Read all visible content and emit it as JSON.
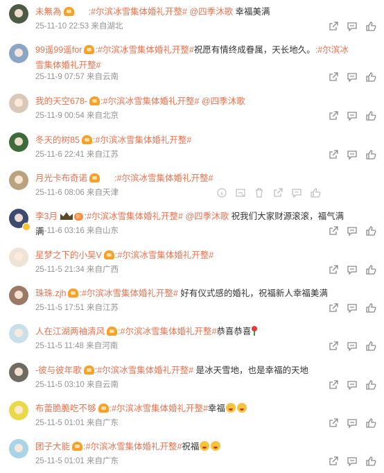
{
  "comments": [
    {
      "name": "未無為",
      "badge": "vip1",
      "level": "",
      "segments": [
        {
          "t": "topic",
          "v": ":#尔滨冰雪集体婚礼开整#"
        },
        {
          "t": "at",
          "v": " @四季沐歌"
        },
        {
          "t": "text",
          "v": " 幸福美满"
        }
      ],
      "time": "25-11-10 22:53",
      "source": "来自湖北",
      "avatar_color": "#4d5b45"
    },
    {
      "name": "99遥99遥for",
      "badge": "crown",
      "level": "",
      "segments": [
        {
          "t": "topic",
          "v": ":#尔滨冰雪集体婚礼开整#"
        },
        {
          "t": "text",
          "v": "祝愿有情终成眷属，天长地久。"
        },
        {
          "t": "topic",
          "v": ":#尔滨冰雪集体婚礼开整#"
        }
      ],
      "time": "25-11-9 07:57",
      "source": "来自云南",
      "avatar_color": "#8aa6c4"
    },
    {
      "name": "我的天空678-",
      "badge": "crown",
      "level": "",
      "segments": [
        {
          "t": "topic",
          "v": ":#尔滨冰雪集体婚礼开整#"
        },
        {
          "t": "at",
          "v": " @四季沐歌"
        }
      ],
      "time": "25-11-9 00:54",
      "source": "来自北京",
      "avatar_color": "#d9c8b8"
    },
    {
      "name": "冬天的树85",
      "badge": "crown",
      "level": "",
      "segments": [
        {
          "t": "topic",
          "v": ":#尔滨冰雪集体婚礼开整#"
        }
      ],
      "time": "25-11-6 22:41",
      "source": "来自江苏",
      "avatar_color": "#3f6b3a"
    },
    {
      "name": "月光卡布奇诺",
      "badge": "vip1",
      "level": "",
      "segments": [
        {
          "t": "topic",
          "v": ":#尔滨冰雪集体婚礼开整#"
        }
      ],
      "time": "25-11-6 08:06",
      "source": "来自天津",
      "avatar_color": "#b9a27d",
      "pale": true
    },
    {
      "name": "李3月",
      "badge": "crown-big",
      "level": "III",
      "segments": [
        {
          "t": "topic",
          "v": ":#尔滨冰雪集体婚礼开整#"
        },
        {
          "t": "at",
          "v": " @四季沐歌"
        },
        {
          "t": "text",
          "v": " 祝我们大家财源滚滚，福气满满"
        }
      ],
      "time": "25-11-6 03:16",
      "source": "来自山东",
      "avatar_color": "#3b4a6e",
      "vip_dot": true
    },
    {
      "name": "星梦之下的小吴V",
      "badge": "crown",
      "level": "",
      "segments": [
        {
          "t": "topic",
          "v": ":#尔滨冰雪集体婚礼开整#"
        }
      ],
      "time": "25-11-5 21:34",
      "source": "来自广西",
      "avatar_color": "#efe2d6"
    },
    {
      "name": "珠珠.zjh",
      "badge": "crown",
      "level": "",
      "segments": [
        {
          "t": "topic",
          "v": ":#尔滨冰雪集体婚礼开整#"
        },
        {
          "t": "text",
          "v": " 好有仪式感的婚礼，祝福新人幸福美满"
        }
      ],
      "time": "25-11-5 17:51",
      "source": "来自江苏",
      "avatar_color": "#9a7a66"
    },
    {
      "name": "人在江湖两袖清风",
      "badge": "crown",
      "level": "",
      "segments": [
        {
          "t": "topic",
          "v": ":#尔滨冰雪集体婚礼开整#"
        },
        {
          "t": "text",
          "v": "恭喜恭喜"
        },
        {
          "t": "rose",
          "v": "rose"
        }
      ],
      "time": "25-11-5 11:48",
      "source": "来自河南",
      "avatar_color": "#c9dfe9"
    },
    {
      "name": "-彼与彼年歌",
      "badge": "crown",
      "level": "",
      "segments": [
        {
          "t": "topic",
          "v": ":#尔滨冰雪集体婚礼开整#"
        },
        {
          "t": "text",
          "v": " 是冰天雪地，也是幸福的天地"
        }
      ],
      "time": "25-11-5 03:10",
      "source": "来自云南",
      "avatar_color": "#6f6a62"
    },
    {
      "name": "布蕾脆脆吃不够",
      "badge": "crown",
      "level": "",
      "segments": [
        {
          "t": "topic",
          "v": ":#尔滨冰雪集体婚礼开整#"
        },
        {
          "t": "text",
          "v": "幸福"
        },
        {
          "t": "emoji",
          "v": "emoji"
        },
        {
          "t": "emoji",
          "v": "emoji"
        }
      ],
      "time": "25-11-5 01:01",
      "source": "来自广东",
      "avatar_color": "#e9d94a"
    },
    {
      "name": "团子大能",
      "badge": "crown",
      "level": "",
      "segments": [
        {
          "t": "topic",
          "v": ":#尔滨冰雪集体婚礼开整#"
        },
        {
          "t": "text",
          "v": "祝福"
        },
        {
          "t": "emoji",
          "v": "emoji"
        },
        {
          "t": "emoji",
          "v": "emoji"
        }
      ],
      "time": "25-11-5 01:01",
      "source": "来自广东",
      "avatar_color": "#a9d3e6"
    }
  ],
  "action_icons": [
    "share-icon",
    "comment-icon",
    "like-icon"
  ],
  "pale_action_icons": [
    "info-icon",
    "hide-icon",
    "delete-icon",
    "share-icon",
    "comment-icon",
    "like-icon"
  ]
}
